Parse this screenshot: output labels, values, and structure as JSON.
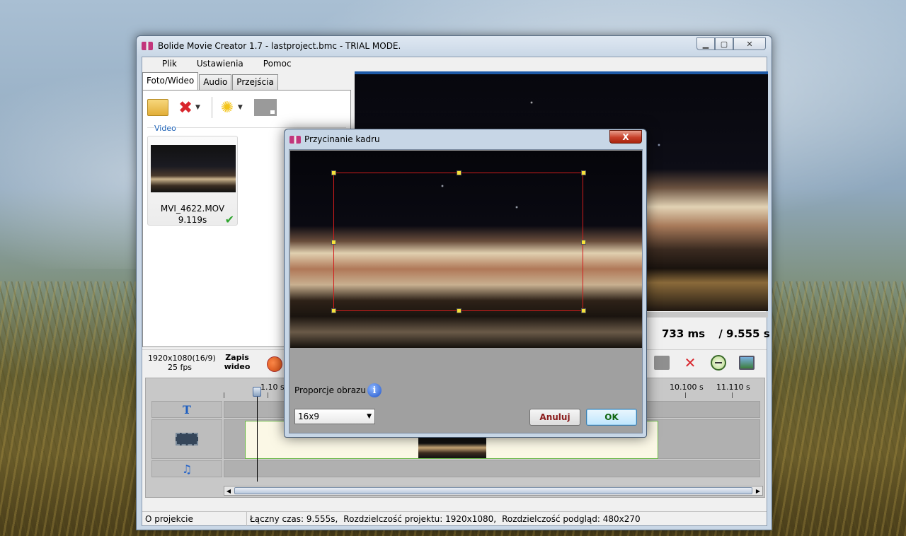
{
  "window": {
    "title": "Bolide Movie Creator 1.7 - lastproject.bmc  - TRIAL MODE."
  },
  "menu": [
    "Plik",
    "Ustawienia",
    "Pomoc"
  ],
  "tabs": [
    "Foto/Wideo",
    "Audio",
    "Przejścia"
  ],
  "left_panel": {
    "section_label": "Video",
    "media": {
      "name": "MVI_4622.MOV",
      "duration": "9.119s"
    }
  },
  "preview": {
    "progress": 0.077,
    "current_time": "733 ms",
    "total_time": "/ 9.555 s"
  },
  "output": {
    "resolution": "1920x1080(16/9)",
    "fps": "25 fps",
    "save_label_line1": "Zapis",
    "save_label_line2": "wideo"
  },
  "timeline": {
    "ticks": [
      "1.10 s",
      "10.100 s",
      "11.110 s"
    ]
  },
  "status": {
    "about": "O projekcie",
    "total_time": "Łączny czas: 9.555s,",
    "project_res": "Rozdzielczość projektu:   1920x1080,",
    "preview_res": "Rozdzielczość podgląd:    480x270"
  },
  "dialog": {
    "title": "Przycinanie kadru",
    "close_label": "X",
    "ratio_label": "Proporcje obrazu",
    "ratio_value": "16x9",
    "cancel_label": "Anuluj",
    "ok_label": "OK"
  }
}
